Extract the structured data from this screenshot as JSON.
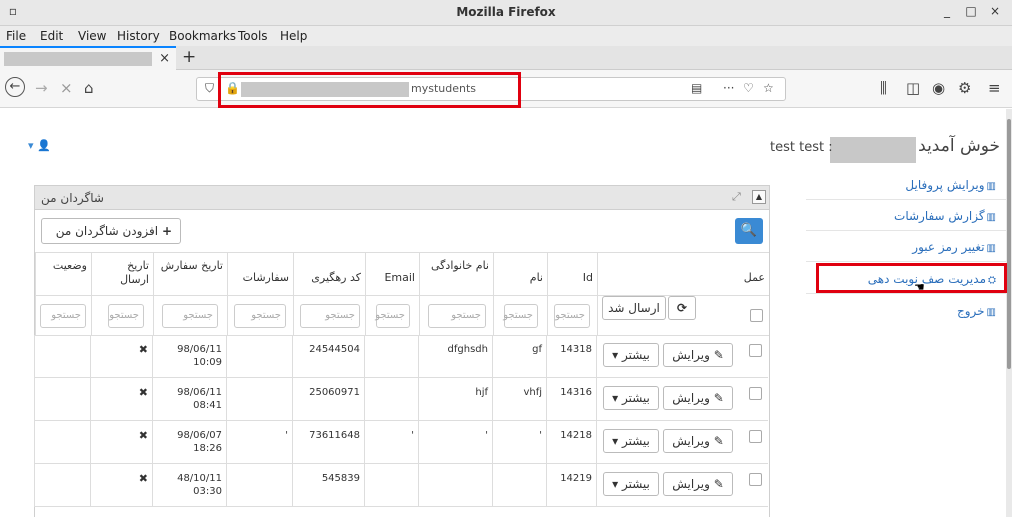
{
  "window": {
    "title": "Mozilla Firefox",
    "min": "_",
    "max": "□",
    "close": "×",
    "appicon": "▫"
  },
  "menu": [
    "File",
    "Edit",
    "View",
    "History",
    "Bookmarks",
    "Tools",
    "Help"
  ],
  "tab": {
    "close": "×",
    "newtab": "+"
  },
  "nav": {
    "back": "←",
    "forward": "→",
    "stop": "×",
    "home": "⌂",
    "url": "mystudents",
    "more": "···"
  },
  "page": {
    "welcome": "خوش آمدید",
    "username": "test test :",
    "sidebar": [
      {
        "label": "ویرایش پروفایل",
        "icon": "▥"
      },
      {
        "label": "گزارش سفارشات",
        "icon": "▥"
      },
      {
        "label": "تغییر رمز عبور",
        "icon": "▥"
      },
      {
        "label": "مدیریت صف نوبت دهی",
        "icon": "⛭"
      },
      {
        "label": "خروج",
        "icon": "▥"
      }
    ],
    "panel": {
      "title": "شاگردان من",
      "add_label": "افزودن شاگردان من",
      "add_icon": "+",
      "search_icon": "🔍",
      "collapse_icon": "▲",
      "expand_icon": "⤢"
    },
    "table": {
      "headers": {
        "action": "عمل",
        "id": "Id",
        "name": "نام",
        "family": "نام خانوادگی",
        "email": "Email",
        "tracking": "کد رهگیری",
        "orders": "سفارشات",
        "order_date": "تاریخ سفارش",
        "send_date": "تاریخ ارسال",
        "status": "وضعیت"
      },
      "filter_placeholders": {
        "id": "جستجو",
        "name": "جستجو",
        "family": "جستجو",
        "email": "جستجو",
        "tracking": "جستجو",
        "orders": "جستجو",
        "order_date": "جستجو",
        "send_date": "جستجو",
        "status": "جستجو"
      },
      "sent_button": "ارسال شد",
      "refresh_icon": "⟳",
      "edit_label": "ویرایش",
      "edit_icon": "✎",
      "more_label": "بیشتر ▾",
      "rows": [
        {
          "id": "14318",
          "name": "gf",
          "family": "dfghsdh",
          "email": "",
          "tracking": "24544504",
          "orders": "",
          "order_date_d": "98/06/11",
          "order_date_t": "10:09",
          "send": "✖",
          "status": ""
        },
        {
          "id": "14316",
          "name": "vhfj",
          "family": "hjf",
          "email": "",
          "tracking": "25060971",
          "orders": "",
          "order_date_d": "98/06/11",
          "order_date_t": "08:41",
          "send": "✖",
          "status": ""
        },
        {
          "id": "14218",
          "name": "'",
          "family": "'",
          "email": "'",
          "tracking": "73611648",
          "orders": "'",
          "order_date_d": "98/06/07",
          "order_date_t": "18:26",
          "send": "✖",
          "status": ""
        },
        {
          "id": "14219",
          "name": "",
          "family": "",
          "email": "",
          "tracking": "545839",
          "orders": "",
          "order_date_d": "48/10/11",
          "order_date_t": "03:30",
          "send": "✖",
          "status": ""
        }
      ]
    }
  }
}
